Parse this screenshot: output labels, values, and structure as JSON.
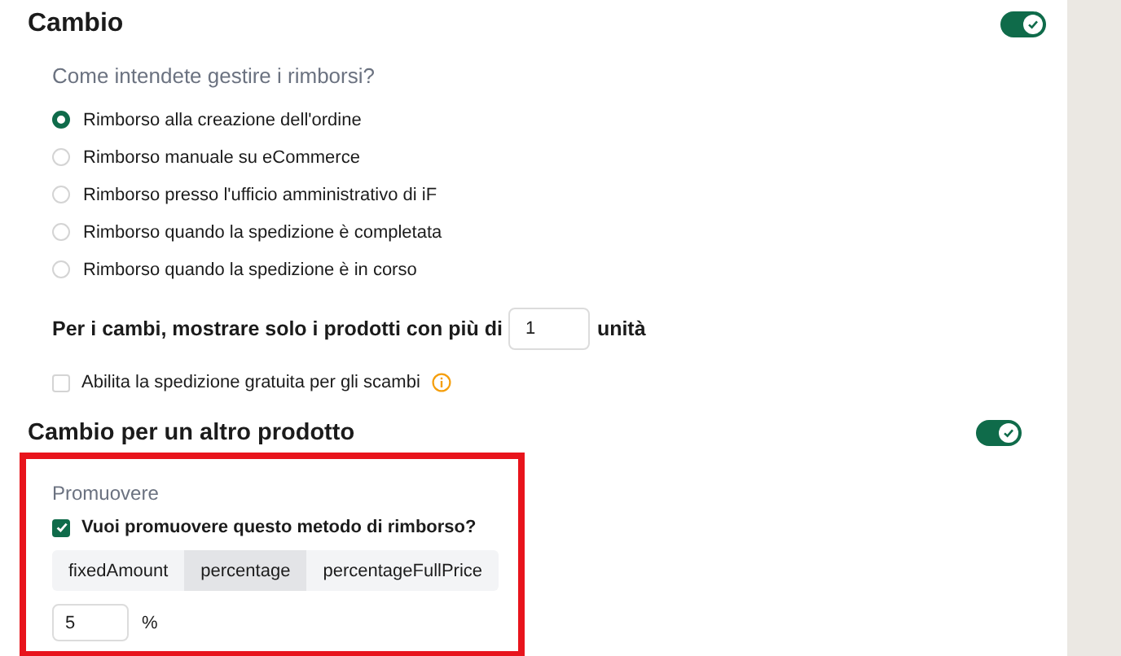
{
  "section": {
    "title": "Cambio",
    "enabled": true
  },
  "refund_question": "Come intendete gestire i rimborsi?",
  "refund_options": [
    {
      "label": "Rimborso alla creazione dell'ordine",
      "selected": true
    },
    {
      "label": "Rimborso manuale su eCommerce",
      "selected": false
    },
    {
      "label": "Rimborso presso l'ufficio amministrativo di iF",
      "selected": false
    },
    {
      "label": "Rimborso quando la spedizione è completata",
      "selected": false
    },
    {
      "label": "Rimborso quando la spedizione è in corso",
      "selected": false
    }
  ],
  "min_units": {
    "label": "Per i cambi, mostrare solo i prodotti con più di",
    "value": "1",
    "suffix": "unità"
  },
  "free_shipping": {
    "label": "Abilita la spedizione gratuita per gli scambi",
    "checked": false
  },
  "other_product": {
    "title": "Cambio per un altro prodotto",
    "enabled": true
  },
  "promote": {
    "heading": "Promuovere",
    "question": "Vuoi promuovere questo metodo di rimborso?",
    "checked": true,
    "modes": [
      {
        "label": "fixedAmount",
        "selected": false
      },
      {
        "label": "percentage",
        "selected": true
      },
      {
        "label": "percentageFullPrice",
        "selected": false
      }
    ],
    "value": "5",
    "unit": "%"
  }
}
